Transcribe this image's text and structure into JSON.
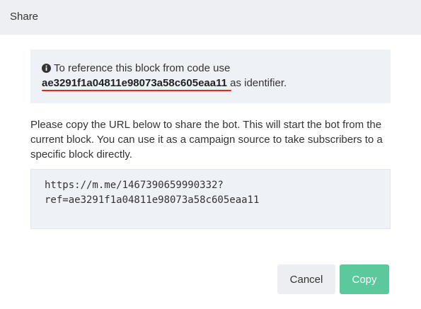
{
  "dialog": {
    "title": "Share"
  },
  "info": {
    "line1": "To reference this block from code use",
    "block_id": "ae3291f1a04811e98073a58c605eaa11",
    "suffix": " as identifier.",
    "icon": "info-circle-icon",
    "underline_color": "#e0261f"
  },
  "description": "Please copy the URL below to share the bot. This will start the bot from the current block. You can use it as a campaign source to take subscribers to a specific block directly.",
  "url": {
    "line1": "https://m.me/1467390659990332?",
    "line2": "ref=ae3291f1a04811e98073a58c605eaa11"
  },
  "buttons": {
    "cancel_label": "Cancel",
    "copy_label": "Copy"
  },
  "colors": {
    "header_bg": "#eeeff3",
    "box_bg": "#eef1f6",
    "copy_button": "#5cc99c"
  }
}
